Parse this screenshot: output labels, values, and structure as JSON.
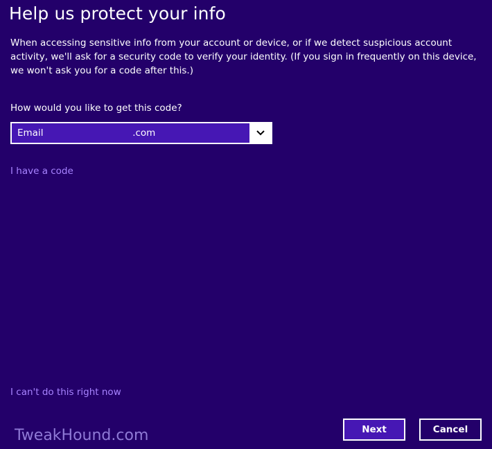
{
  "page": {
    "title": "Help us protect your info",
    "description": "When accessing sensitive info from your account or device, or if we detect suspicious account activity, we'll ask for a security code to verify your identity. (If you sign in frequently on this device, we won't ask you for a code after this.)",
    "question": "How would you like to get this code?"
  },
  "method_select": {
    "selected": "Email                              .com",
    "arrow_icon": "chevron-down-icon"
  },
  "links": {
    "have_code": "I have a code",
    "cant_now": "I can't do this right now"
  },
  "buttons": {
    "next": "Next",
    "cancel": "Cancel"
  },
  "watermark": "TweakHound.com",
  "colors": {
    "background": "#23006a",
    "accent": "#4617b4",
    "link": "#a783ff"
  }
}
